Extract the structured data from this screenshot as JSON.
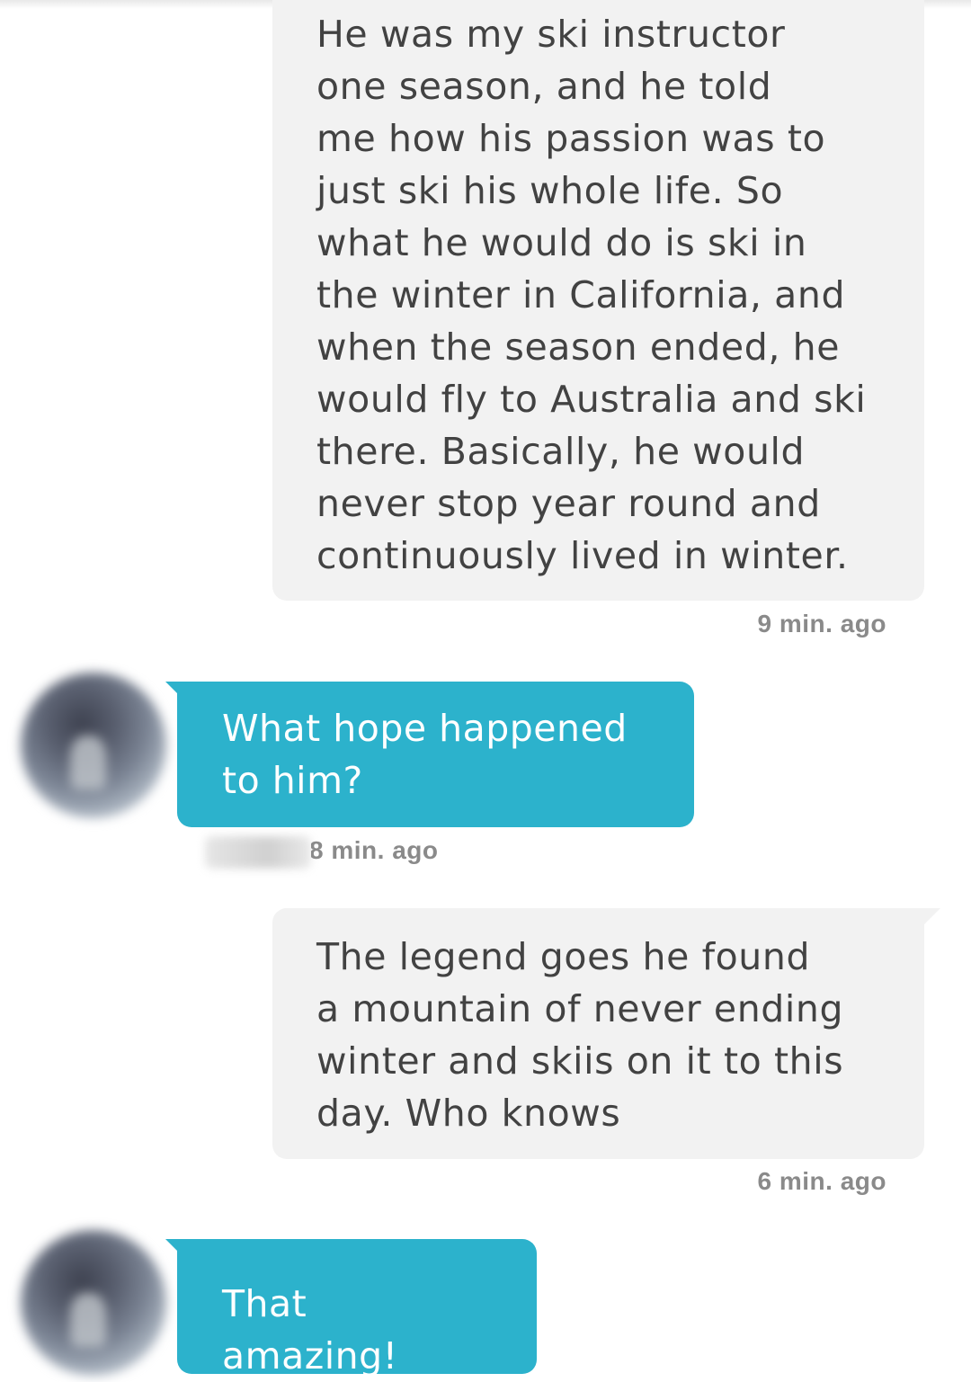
{
  "conversation": {
    "messages": [
      {
        "direction": "outgoing",
        "text": "He was my ski instructor\none season, and he told\nme how his passion was to\njust ski his whole life. So\nwhat he would do is ski in\nthe winter in California, and\nwhen the season ended, he\nwould fly to Australia and ski\nthere. Basically, he would\nnever stop year round and\ncontinuously lived in winter.",
        "time": "9 min. ago"
      },
      {
        "direction": "incoming",
        "text": "What hope happened\nto him?",
        "time": "8 min. ago"
      },
      {
        "direction": "outgoing",
        "text": "The legend goes he found\na mountain of never ending\nwinter and skiis on it to this\nday. Who knows",
        "time": "6 min. ago"
      },
      {
        "direction": "incoming",
        "text": "That amazing!",
        "time": ""
      }
    ]
  },
  "colors": {
    "outgoing_bubble": "#f2f2f2",
    "outgoing_text": "#424242",
    "incoming_bubble": "#2cb2cc",
    "incoming_text": "#ffffff",
    "timestamp": "#8a8a8a"
  }
}
